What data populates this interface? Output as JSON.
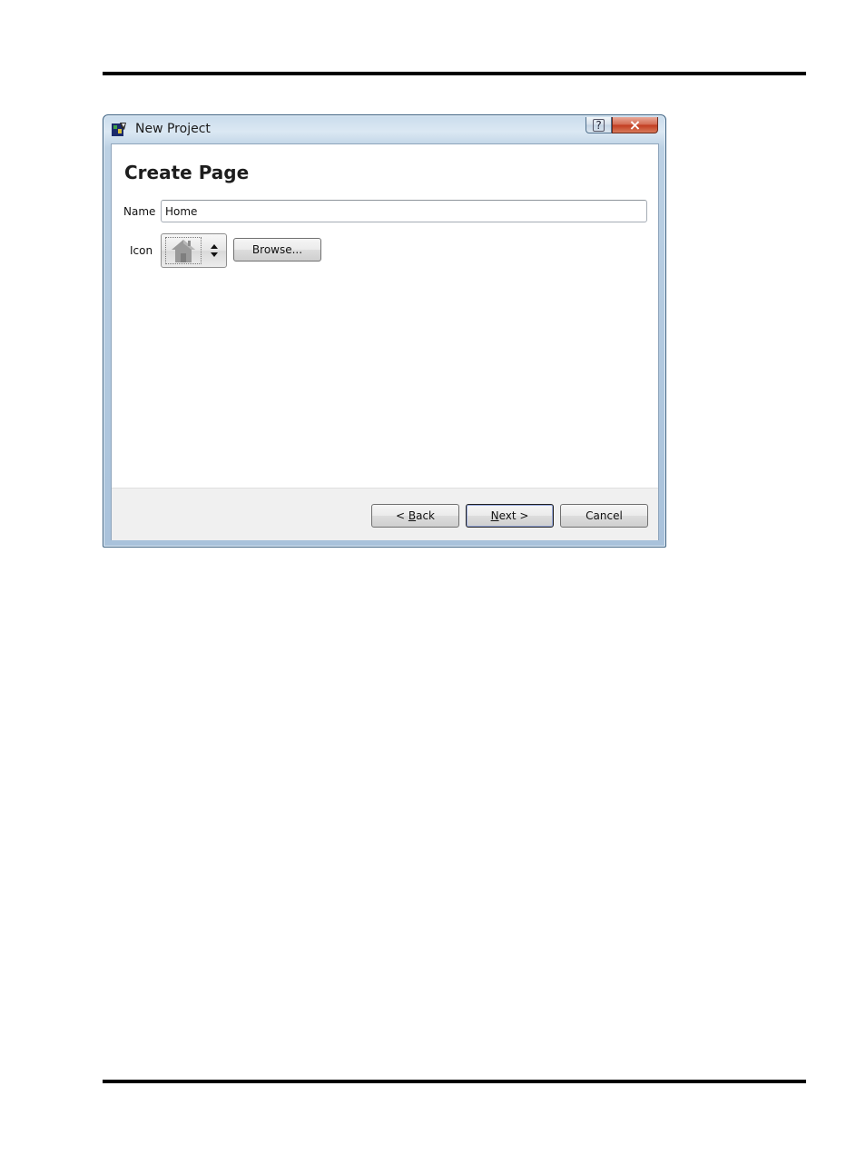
{
  "window": {
    "title": "New Project",
    "help_glyph": "?",
    "close_glyph": "×",
    "app_icon": "project-app-icon"
  },
  "page": {
    "title": "Create Page"
  },
  "form": {
    "name_label": "Name",
    "name_value": "Home",
    "icon_label": "Icon",
    "icon_selected": "home-icon",
    "browse_label": "Browse..."
  },
  "footer": {
    "back_pre": "< ",
    "back_mnemonic": "B",
    "back_post": "ack",
    "next_mnemonic": "N",
    "next_post": "ext >",
    "cancel_label": "Cancel"
  },
  "colors": {
    "titlebar": "#c9dcec",
    "close_button": "#c23b1f",
    "footer_bg": "#f0f0f0"
  }
}
